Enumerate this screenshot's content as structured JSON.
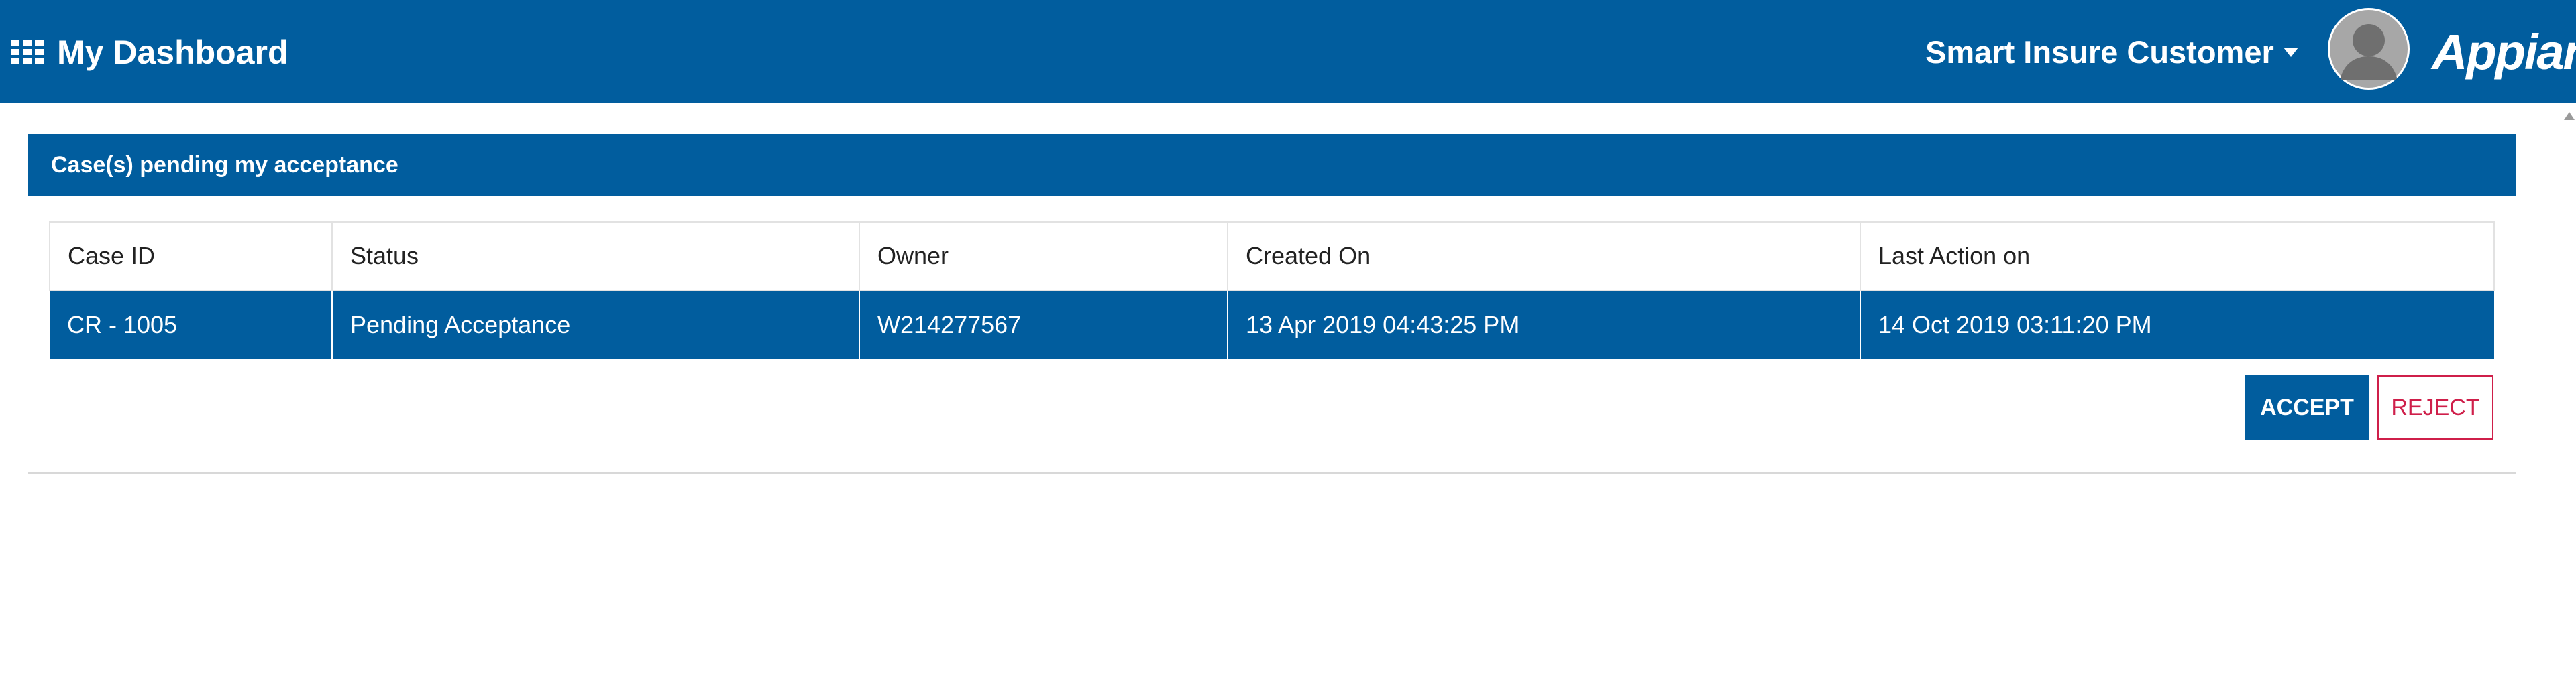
{
  "header": {
    "title": "My Dashboard",
    "user_name": "Smart Insure Customer",
    "logo_text": "Appian"
  },
  "panel": {
    "title": "Case(s) pending my acceptance"
  },
  "table": {
    "columns": [
      "Case ID",
      "Status",
      "Owner",
      "Created On",
      "Last Action on"
    ],
    "rows": [
      [
        "CR - 1005",
        "Pending Acceptance",
        "W214277567",
        "13 Apr 2019 04:43:25 PM",
        "14 Oct 2019 03:11:20 PM"
      ]
    ]
  },
  "actions": {
    "accept_label": "ACCEPT",
    "reject_label": "REJECT"
  },
  "colors": {
    "brand_blue": "#015d9e",
    "reject_red": "#cf1f4a"
  },
  "icons": {
    "menu": "grid-icon",
    "user_dropdown": "caret-down-icon",
    "avatar": "user-avatar-icon"
  }
}
